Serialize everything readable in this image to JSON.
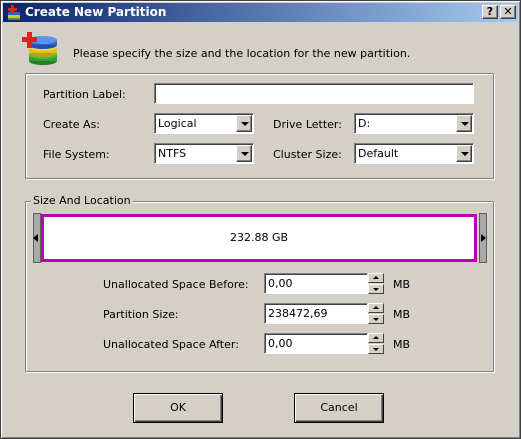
{
  "window": {
    "title": "Create New Partition",
    "help_label": "?",
    "close_label": "✕"
  },
  "intro": "Please specify the size and the location for the new partition.",
  "form": {
    "partition_label": {
      "label": "Partition Label:",
      "value": ""
    },
    "create_as": {
      "label": "Create As:",
      "value": "Logical"
    },
    "drive_letter": {
      "label": "Drive Letter:",
      "value": "D:"
    },
    "file_system": {
      "label": "File System:",
      "value": "NTFS"
    },
    "cluster_size": {
      "label": "Cluster Size:",
      "value": "Default"
    }
  },
  "size_location": {
    "legend": "Size And Location",
    "partition_size_display": "232.88 GB",
    "unallocated_before": {
      "label": "Unallocated Space Before:",
      "value": "0,00",
      "unit": "MB"
    },
    "partition_size": {
      "label": "Partition Size:",
      "value": "238472,69",
      "unit": "MB"
    },
    "unallocated_after": {
      "label": "Unallocated Space After:",
      "value": "0,00",
      "unit": "MB"
    }
  },
  "buttons": {
    "ok": "OK",
    "cancel": "Cancel"
  },
  "colors": {
    "title_start": "#0a246a",
    "title_end": "#a6caf0",
    "partition_border": "#b800b8"
  }
}
